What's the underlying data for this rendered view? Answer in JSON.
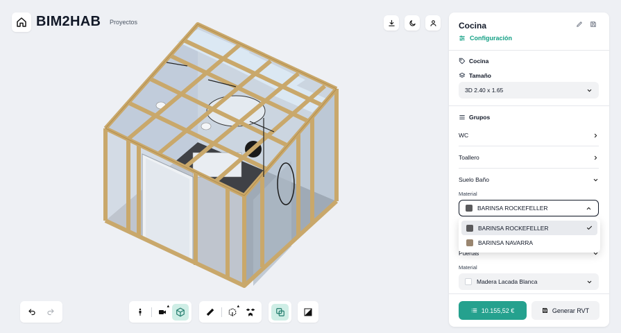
{
  "header": {
    "brand": "BIM2HAB",
    "nav_link": "Proyectos"
  },
  "top_icons": [
    "download-icon",
    "moon-icon",
    "user-icon"
  ],
  "panel": {
    "title": "Cocina",
    "config_label": "Configuración",
    "name_label": "Cocina",
    "size_label": "Tamaño",
    "size_value": "3D 2.40 x 1.65",
    "groups_label": "Grupos",
    "groups": [
      {
        "label": "WC"
      },
      {
        "label": "Toallero"
      },
      {
        "label": "Suelo Baño"
      }
    ],
    "material_label": "Material",
    "suelo_material": "BARINSA ROCKEFELLER",
    "dropdown_options": [
      {
        "label": "BARINSA ROCKEFELLER",
        "color": "#5a5a5c",
        "selected": true
      },
      {
        "label": "BARINSA NAVARRA",
        "color": "#9a8670",
        "selected": false
      }
    ],
    "puertas_label": "Puertas",
    "puertas_material_label": "Material",
    "puertas_material": "Madera Lacada Blanca",
    "price": "10.155,52 €",
    "generate_label": "Generar RVT"
  },
  "colors": {
    "accent": "#25a18e",
    "accent_text": "#14a085",
    "active_tool": "#cfeee6",
    "swatch_rockefeller": "#5a5a5c",
    "swatch_madera": "#ffffff"
  }
}
